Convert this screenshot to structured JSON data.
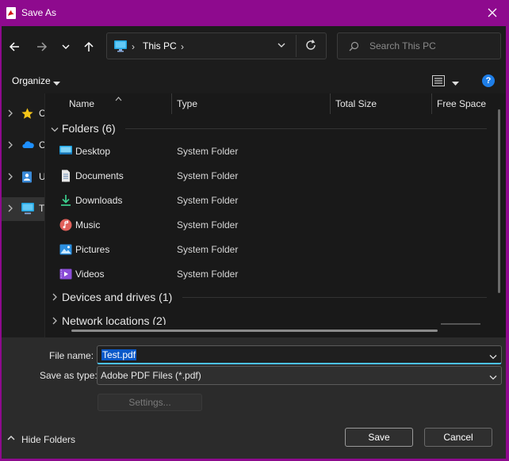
{
  "window": {
    "title": "Save As",
    "brand_color": "#8e0a8e"
  },
  "address": {
    "location": "This PC",
    "search_placeholder": "Search This PC"
  },
  "toolbar": {
    "organize_label": "Organize"
  },
  "nav_pane": {
    "items": [
      {
        "icon": "star-icon",
        "label": "C"
      },
      {
        "icon": "cloud-icon",
        "label": "C"
      },
      {
        "icon": "user-folder-icon",
        "label": "U"
      },
      {
        "icon": "pc-icon",
        "label": "T",
        "selected": true
      }
    ]
  },
  "columns": [
    "Name",
    "Type",
    "Total Size",
    "Free Space"
  ],
  "groups": {
    "folders_label": "Folders (6)",
    "devices_label": "Devices and drives (1)",
    "network_label": "Network locations (2)"
  },
  "folders": [
    {
      "name": "Desktop",
      "type": "System Folder",
      "icon": "desktop-icon"
    },
    {
      "name": "Documents",
      "type": "System Folder",
      "icon": "documents-icon"
    },
    {
      "name": "Downloads",
      "type": "System Folder",
      "icon": "download-icon"
    },
    {
      "name": "Music",
      "type": "System Folder",
      "icon": "music-icon"
    },
    {
      "name": "Pictures",
      "type": "System Folder",
      "icon": "pictures-icon"
    },
    {
      "name": "Videos",
      "type": "System Folder",
      "icon": "videos-icon"
    }
  ],
  "form": {
    "file_name_label": "File name:",
    "file_name_value": "Test.pdf",
    "save_type_label": "Save as type:",
    "save_type_value": "Adobe PDF Files (*.pdf)",
    "settings_label": "Settings..."
  },
  "footer": {
    "hide_folders_label": "Hide Folders",
    "save_label": "Save",
    "cancel_label": "Cancel"
  },
  "colors": {
    "accent": "#4cc2ff",
    "selection": "#0a58c8",
    "help": "#1e7ee8"
  }
}
